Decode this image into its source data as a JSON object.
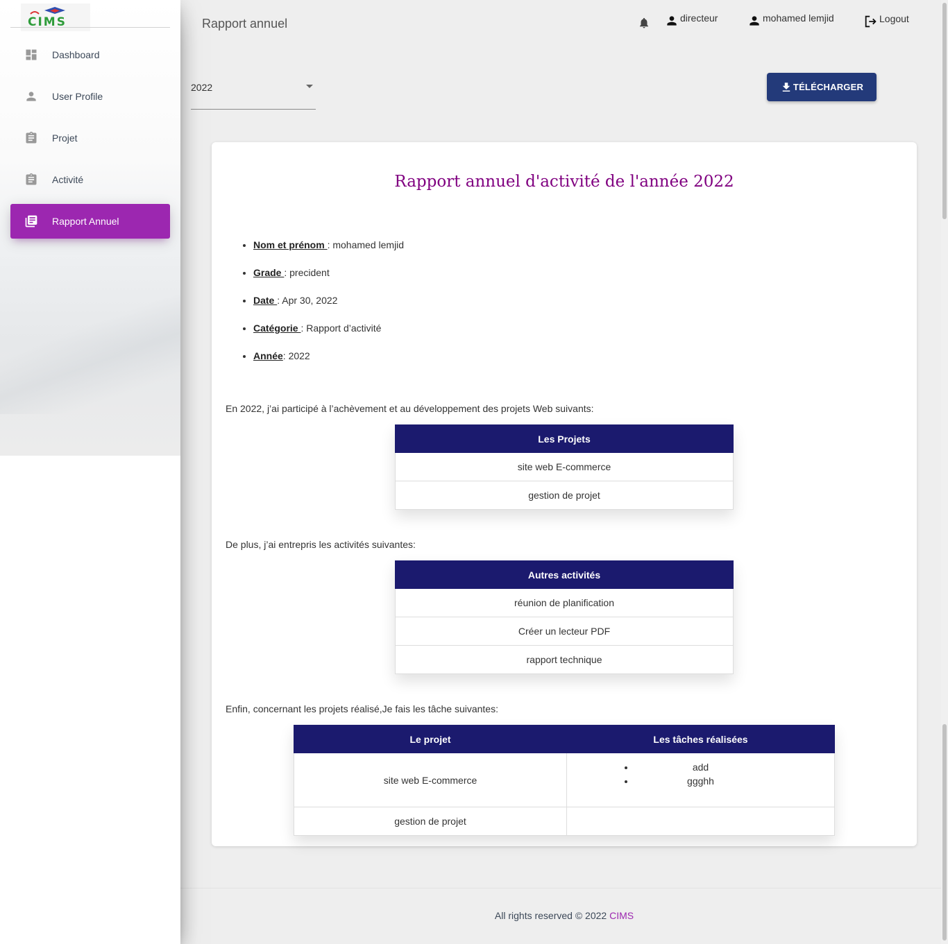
{
  "app": {
    "logo_text": "CIMS"
  },
  "sidebar": {
    "items": [
      {
        "label": "Dashboard",
        "icon": "dashboard-icon"
      },
      {
        "label": "User Profile",
        "icon": "person-icon"
      },
      {
        "label": "Projet",
        "icon": "clipboard-icon"
      },
      {
        "label": "Activité",
        "icon": "clipboard-icon"
      },
      {
        "label": "Rapport Annuel",
        "icon": "library-books-icon",
        "active": true
      }
    ],
    "active_color": "#9c27b0"
  },
  "header": {
    "title": "Rapport annuel",
    "role": "directeur",
    "user": "mohamed lemjid",
    "logout": "Logout"
  },
  "controls": {
    "year": "2022",
    "download_label": "TÉLÉCHARGER"
  },
  "report": {
    "title": "Rapport annuel d'activité de l'année 2022",
    "info": [
      {
        "label": "Nom et prénom ",
        "sep": ": ",
        "value": "mohamed lemjid"
      },
      {
        "label": "Grade ",
        "sep": ": ",
        "value": "precident"
      },
      {
        "label": "Date ",
        "sep": ": ",
        "value": "Apr 30, 2022"
      },
      {
        "label": "Catégorie ",
        "sep": ": ",
        "value": "Rapport d’activité"
      },
      {
        "label": "Année",
        "sep": ": ",
        "value": "2022"
      }
    ],
    "projects_intro": "En 2022, j’ai participé à l’achèvement et au développement des projets Web suivants:",
    "projects_header": "Les Projets",
    "projects": [
      "site web E-commerce",
      "gestion de projet"
    ],
    "activities_intro": "De plus, j’ai entrepris les activités suivantes:",
    "activities_header": "Autres activités",
    "activities": [
      "réunion de planification",
      "Créer un lecteur PDF",
      "rapport technique"
    ],
    "tasks_intro": "Enfin, concernant les projets réalisé,Je fais les tâche suivantes:",
    "tasks_headers": [
      "Le projet",
      "Les tâches réalisées"
    ],
    "tasks_rows": [
      {
        "project": "site web E-commerce",
        "tasks": [
          "add",
          "ggghh"
        ]
      },
      {
        "project": "gestion de projet",
        "tasks": []
      }
    ],
    "table_header_color": "#1b1a6e",
    "title_color": "#800080"
  },
  "footer": {
    "text": "All rights reserved © 2022 ",
    "brand": "CIMS",
    "brand_color": "#9c27b0"
  }
}
